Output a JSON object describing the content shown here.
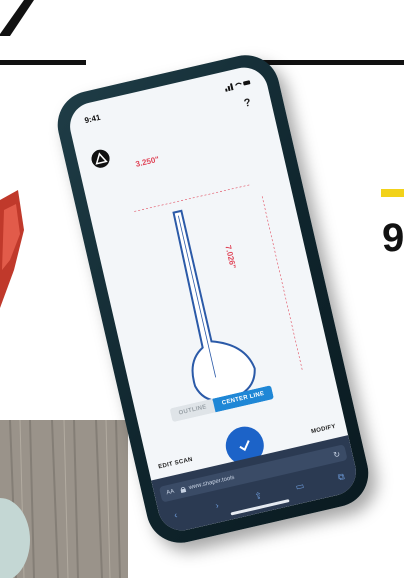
{
  "page": {
    "number": "9",
    "colors": {
      "accent_yellow": "#f2d21a",
      "rule": "#111111",
      "red_object": "#c0392b"
    }
  },
  "phone": {
    "status": {
      "time": "9:41"
    },
    "help_label": "?",
    "measurements": {
      "width": "3.250\"",
      "height": "7.026\""
    },
    "view_toggle": {
      "outline_label": "OUTLINE",
      "center_line_label": "CENTER LINE",
      "selected": "CENTER LINE"
    },
    "actions": {
      "edit_scan": "EDIT SCAN",
      "modify": "MODIFY"
    },
    "browser": {
      "aa_label": "AA",
      "url": "www.shaper.tools",
      "reload_icon": "reload-icon"
    },
    "colors": {
      "dimension": "#e0475a",
      "primary": "#1c63c8",
      "segment_active": "#1f87d6",
      "browser_bar": "#2b3a52"
    }
  }
}
